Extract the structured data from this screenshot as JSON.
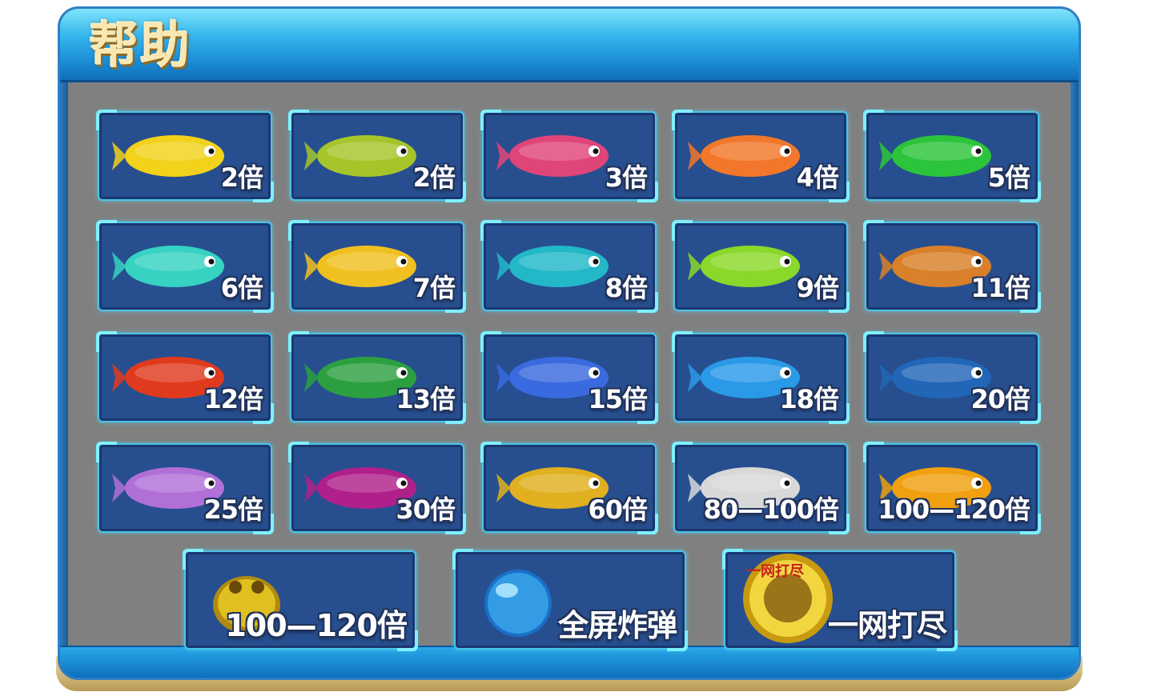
{
  "title": "帮助",
  "rows": [
    [
      {
        "label": "2倍",
        "icon": "yellow-shrimp-fish-icon",
        "color": "#f2d21a"
      },
      {
        "label": "2倍",
        "icon": "green-puffer-fish-icon",
        "color": "#a6c52a"
      },
      {
        "label": "3倍",
        "icon": "pink-butterfly-fish-icon",
        "color": "#e0457a"
      },
      {
        "label": "4倍",
        "icon": "clownfish-icon",
        "color": "#f2772a"
      },
      {
        "label": "5倍",
        "icon": "green-spiky-puffer-icon",
        "color": "#2cc43a"
      }
    ],
    [
      {
        "label": "6倍",
        "icon": "teal-goldfish-icon",
        "color": "#36d2c2"
      },
      {
        "label": "7倍",
        "icon": "angelfish-icon",
        "color": "#f0c020"
      },
      {
        "label": "8倍",
        "icon": "seahorse-icon",
        "color": "#22b8c8"
      },
      {
        "label": "9倍",
        "icon": "striped-frog-fish-icon",
        "color": "#8ad82a"
      },
      {
        "label": "11倍",
        "icon": "sea-turtle-icon",
        "color": "#d8802a"
      }
    ],
    [
      {
        "label": "12倍",
        "icon": "lobster-icon",
        "color": "#e03a1e"
      },
      {
        "label": "13倍",
        "icon": "green-catfish-icon",
        "color": "#2ca040"
      },
      {
        "label": "15倍",
        "icon": "manta-ray-icon",
        "color": "#3a6ae0"
      },
      {
        "label": "18倍",
        "icon": "blue-spotted-fish-icon",
        "color": "#2a9ae8"
      },
      {
        "label": "20倍",
        "icon": "blue-shark-icon",
        "color": "#2266b8"
      }
    ],
    [
      {
        "label": "25倍",
        "icon": "mermaid-icon",
        "color": "#b070d8"
      },
      {
        "label": "30倍",
        "icon": "purple-sawfish-icon",
        "color": "#b0208a"
      },
      {
        "label": "60倍",
        "icon": "golden-swordfish-icon",
        "color": "#e0b020"
      },
      {
        "label": "80—100倍",
        "icon": "silver-dragon-icon",
        "color": "#d8d8d8"
      },
      {
        "label": "100—120倍",
        "icon": "golden-dragon-icon",
        "color": "#f0a010"
      }
    ]
  ],
  "bottom": [
    {
      "label": "100—120倍",
      "icon": "golden-toad-icon",
      "color": "#e0c020"
    },
    {
      "label": "全屏炸弹",
      "icon": "blue-bubble-bomb-icon",
      "color": "#3aa0e8"
    },
    {
      "label": "一网打尽",
      "icon": "golden-net-coin-icon",
      "color": "#e8c020",
      "coin_text": "一网打尽"
    }
  ]
}
